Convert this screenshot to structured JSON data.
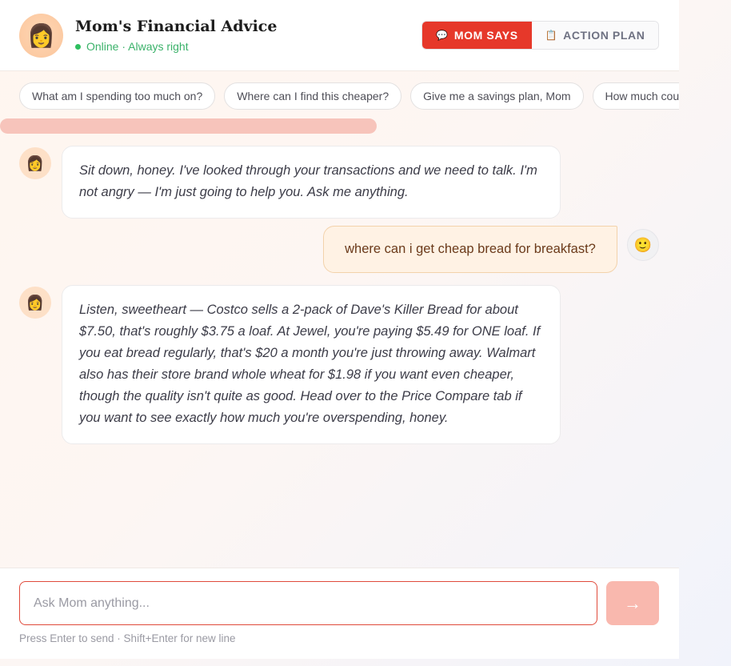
{
  "header": {
    "avatar_emoji": "👩",
    "title": "Mom's Financial Advice",
    "status": "Online · Always right",
    "tabs": [
      {
        "label": "MOM SAYS",
        "icon": "💬",
        "icon_name": "speech-bubble-icon",
        "active": true
      },
      {
        "label": "ACTION PLAN",
        "icon": "📋",
        "icon_name": "clipboard-icon",
        "active": false
      }
    ]
  },
  "chips": [
    "What am I spending too much on?",
    "Where can I find this cheaper?",
    "Give me a savings plan, Mom",
    "How much could I save?"
  ],
  "messages": [
    {
      "role": "mom",
      "avatar": "👩",
      "text": "Sit down, honey. I've looked through your transactions and we need to talk. I'm not angry — I'm just going to help you. Ask me anything."
    },
    {
      "role": "user",
      "avatar": "🙂",
      "text": "where can i get cheap bread for breakfast?"
    },
    {
      "role": "mom",
      "avatar": "👩",
      "text": "Listen, sweetheart — Costco sells a 2-pack of Dave's Killer Bread for about $7.50, that's roughly $3.75 a loaf. At Jewel, you're paying $5.49 for ONE loaf. If you eat bread regularly, that's $20 a month you're just throwing away. Walmart also has their store brand whole wheat for $1.98 if you want even cheaper, though the quality isn't quite as good. Head over to the Price Compare tab if you want to see exactly how much you're overspending, honey."
    }
  ],
  "composer": {
    "placeholder": "Ask Mom anything...",
    "value": "",
    "send_icon": "→",
    "hint": "Press Enter to send · Shift+Enter for new line"
  },
  "colors": {
    "accent": "#e6382a",
    "online": "#2fbf60",
    "user_bubble": "#fff2e4",
    "send_button": "#f9b8ae"
  }
}
